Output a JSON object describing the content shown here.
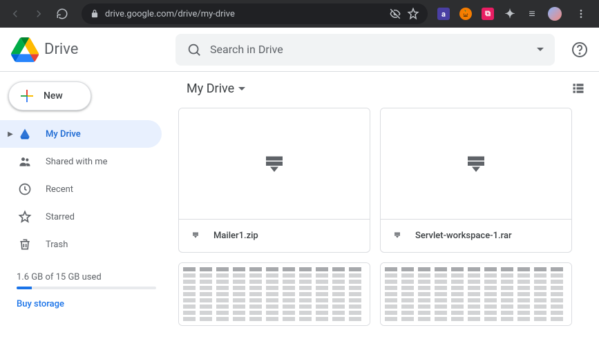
{
  "browser": {
    "url": "drive.google.com/drive/my-drive"
  },
  "app": {
    "name": "Drive",
    "search_placeholder": "Search in Drive"
  },
  "sidebar": {
    "new_label": "New",
    "items": [
      {
        "label": "My Drive"
      },
      {
        "label": "Shared with me"
      },
      {
        "label": "Recent"
      },
      {
        "label": "Starred"
      },
      {
        "label": "Trash"
      }
    ],
    "storage_text": "1.6 GB of 15 GB used",
    "buy_label": "Buy storage"
  },
  "breadcrumb": {
    "current": "My Drive"
  },
  "files": [
    {
      "name": "Mailer1.zip",
      "type": "archive"
    },
    {
      "name": "Servlet-workspace-1.rar",
      "type": "archive"
    }
  ]
}
